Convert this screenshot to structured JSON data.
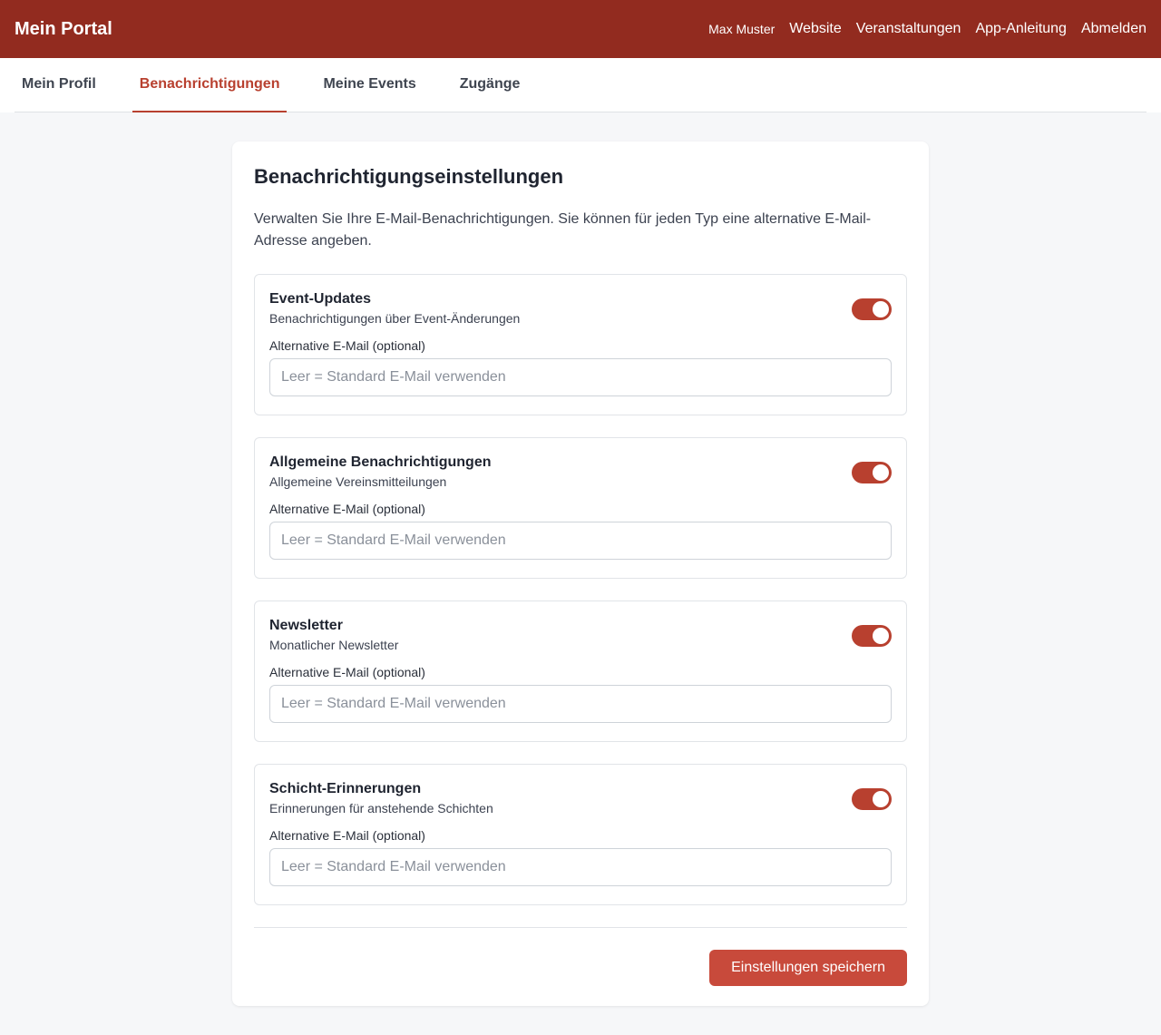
{
  "header": {
    "brand": "Mein Portal",
    "user": "Max Muster",
    "links": [
      "Website",
      "Veranstaltungen",
      "App-Anleitung",
      "Abmelden"
    ]
  },
  "tabs": [
    {
      "label": "Mein Profil",
      "active": false
    },
    {
      "label": "Benachrichtigungen",
      "active": true
    },
    {
      "label": "Meine Events",
      "active": false
    },
    {
      "label": "Zugänge",
      "active": false
    }
  ],
  "page": {
    "title": "Benachrichtigungseinstellungen",
    "intro": "Verwalten Sie Ihre E-Mail-Benachrichtigungen. Sie können für jeden Typ eine alternative E-Mail-Adresse angeben."
  },
  "settings": [
    {
      "title": "Event-Updates",
      "description": "Benachrichtigungen über Event-Änderungen",
      "enabled": true,
      "email_label": "Alternative E-Mail (optional)",
      "email_value": "",
      "email_placeholder": "Leer = Standard E-Mail verwenden"
    },
    {
      "title": "Allgemeine Benachrichtigungen",
      "description": "Allgemeine Vereinsmitteilungen",
      "enabled": true,
      "email_label": "Alternative E-Mail (optional)",
      "email_value": "",
      "email_placeholder": "Leer = Standard E-Mail verwenden"
    },
    {
      "title": "Newsletter",
      "description": "Monatlicher Newsletter",
      "enabled": true,
      "email_label": "Alternative E-Mail (optional)",
      "email_value": "",
      "email_placeholder": "Leer = Standard E-Mail verwenden"
    },
    {
      "title": "Schicht-Erinnerungen",
      "description": "Erinnerungen für anstehende Schichten",
      "enabled": true,
      "email_label": "Alternative E-Mail (optional)",
      "email_value": "",
      "email_placeholder": "Leer = Standard E-Mail verwenden"
    }
  ],
  "actions": {
    "save_label": "Einstellungen speichern"
  },
  "colors": {
    "header_bg": "#922b1f",
    "accent": "#b8402f",
    "button": "#c84a3b"
  }
}
